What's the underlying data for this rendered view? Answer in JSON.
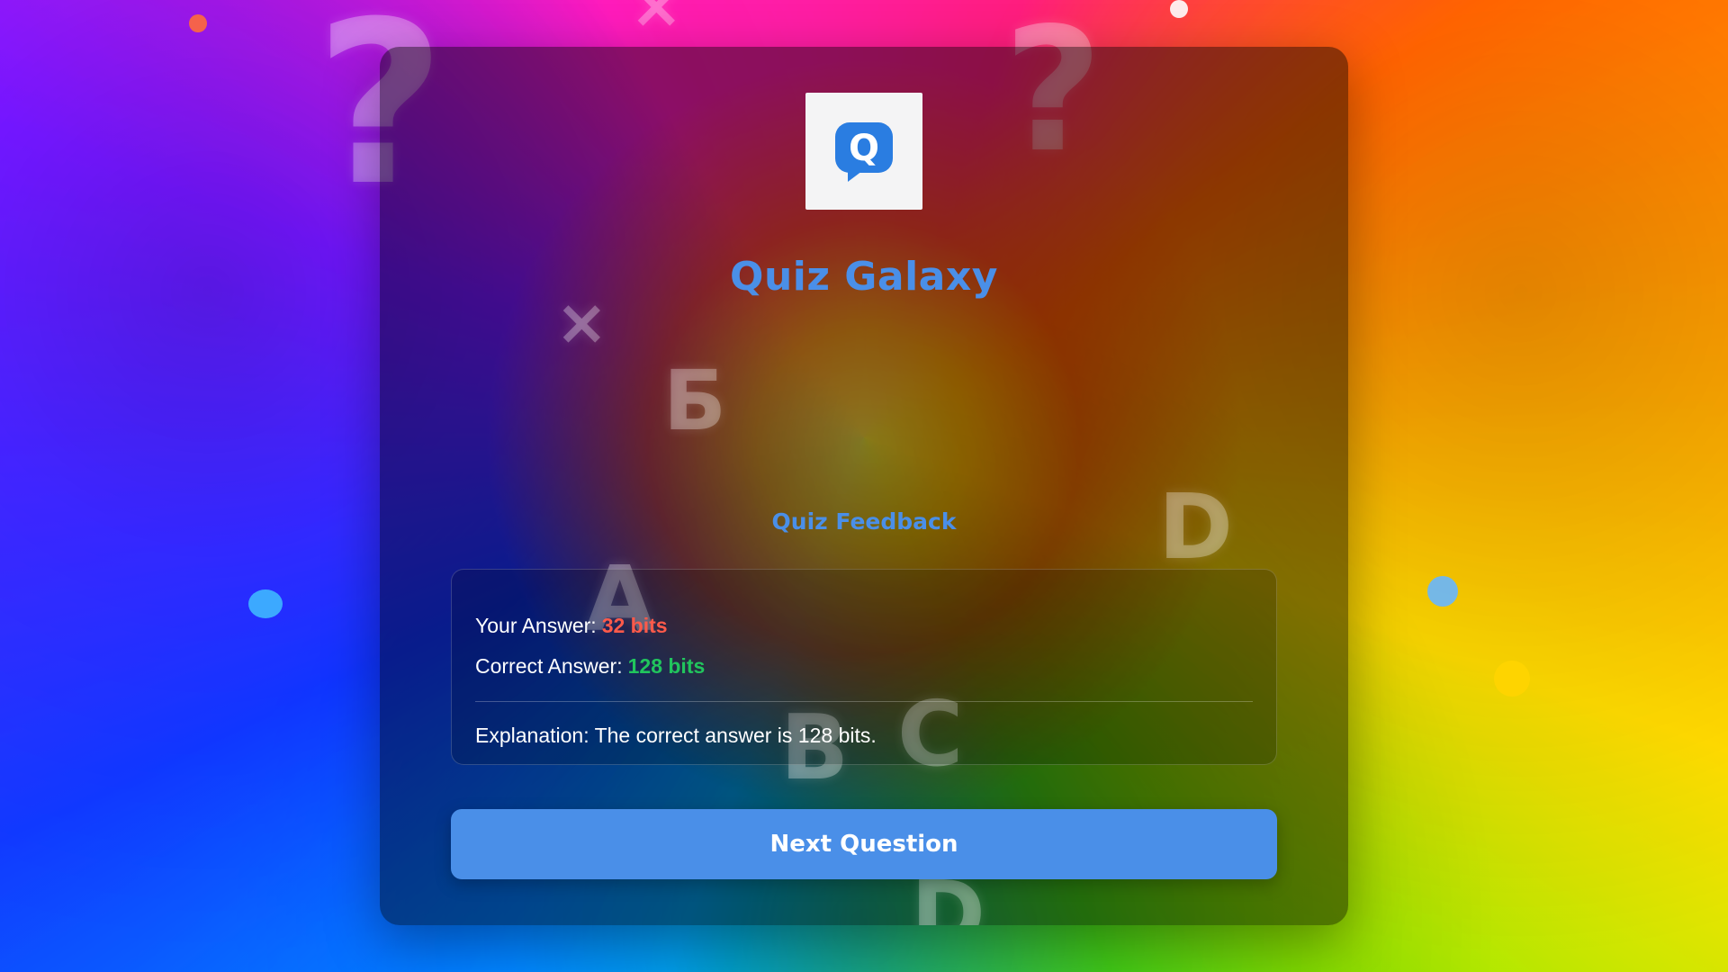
{
  "app": {
    "title": "Quiz Galaxy",
    "logo_icon": "quiz-speech-bubble-icon",
    "logo_letter": "Q",
    "accent_color": "#4a8fe8"
  },
  "feedback": {
    "heading": "Quiz Feedback",
    "your_answer_label": "Your Answer:",
    "your_answer_value": "32 bits",
    "correct_answer_label": "Correct Answer:",
    "correct_answer_value": "128 bits",
    "explanation": "Explanation: The correct answer is 128 bits.",
    "wrong_color": "#ff5a4a",
    "correct_color": "#21c55d"
  },
  "actions": {
    "next_label": "Next Question"
  },
  "background": {
    "decor_glyphs": [
      "?",
      "?",
      "?",
      "×",
      "×",
      "Б",
      "A",
      "B",
      "C",
      "D",
      "D"
    ]
  }
}
